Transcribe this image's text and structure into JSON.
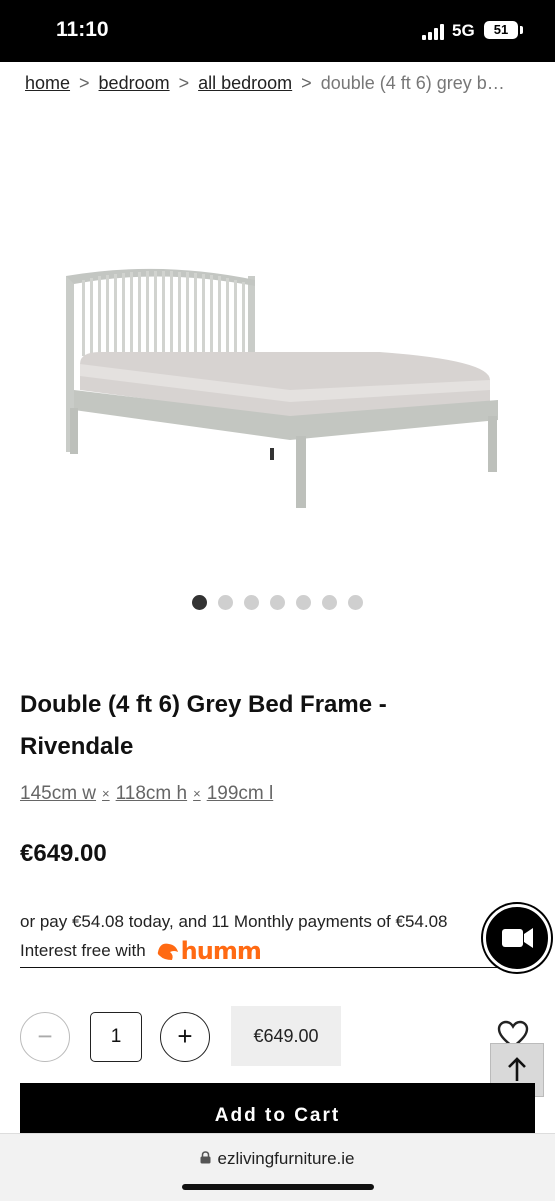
{
  "status_bar": {
    "time": "11:10",
    "network": "5G",
    "battery": "51"
  },
  "breadcrumb": {
    "items": [
      "home",
      "bedroom",
      "all bedroom"
    ],
    "current": "double (4 ft 6) grey b…",
    "separator": ">"
  },
  "carousel": {
    "count": 7,
    "active": 0
  },
  "product": {
    "title": "Double (4 ft 6) Grey Bed Frame - Rivendale",
    "dimensions": {
      "width": "145cm w",
      "height": "118cm h",
      "length": "199cm l",
      "separator": "×"
    },
    "price": "€649.00"
  },
  "finance": {
    "line1": "or pay €54.08 today, and 11 Monthly payments of €54.08",
    "line2": "Interest free with",
    "provider": "humm",
    "provider_color": "#ff6a13"
  },
  "quantity": {
    "minus": "−",
    "value": "1",
    "plus": "+"
  },
  "total": "€649.00",
  "actions": {
    "add_to_cart": "Add to Cart"
  },
  "icons": {
    "video": "video-camera-icon",
    "wishlist": "heart-icon",
    "back_to_top": "arrow-up-icon"
  },
  "browser": {
    "url": "ezlivingfurniture.ie"
  }
}
